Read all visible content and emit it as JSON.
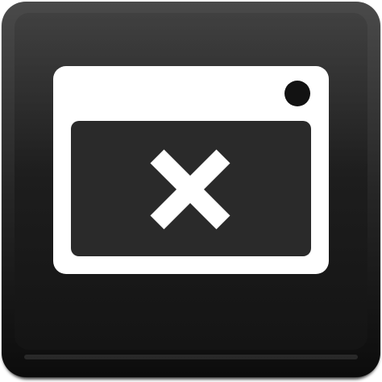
{
  "icon": {
    "name": "window-close-button",
    "style": "black glossy square button",
    "glyph": "close-window-icon",
    "colors": {
      "button_face": "#1c1c1c",
      "button_edge": "#3a3a3a",
      "button_shadow": "#0a0a0a",
      "window_frame": "#ffffff",
      "window_content": "#2a2a2a",
      "close_mark": "#ffffff",
      "title_dot": "#121212"
    }
  }
}
